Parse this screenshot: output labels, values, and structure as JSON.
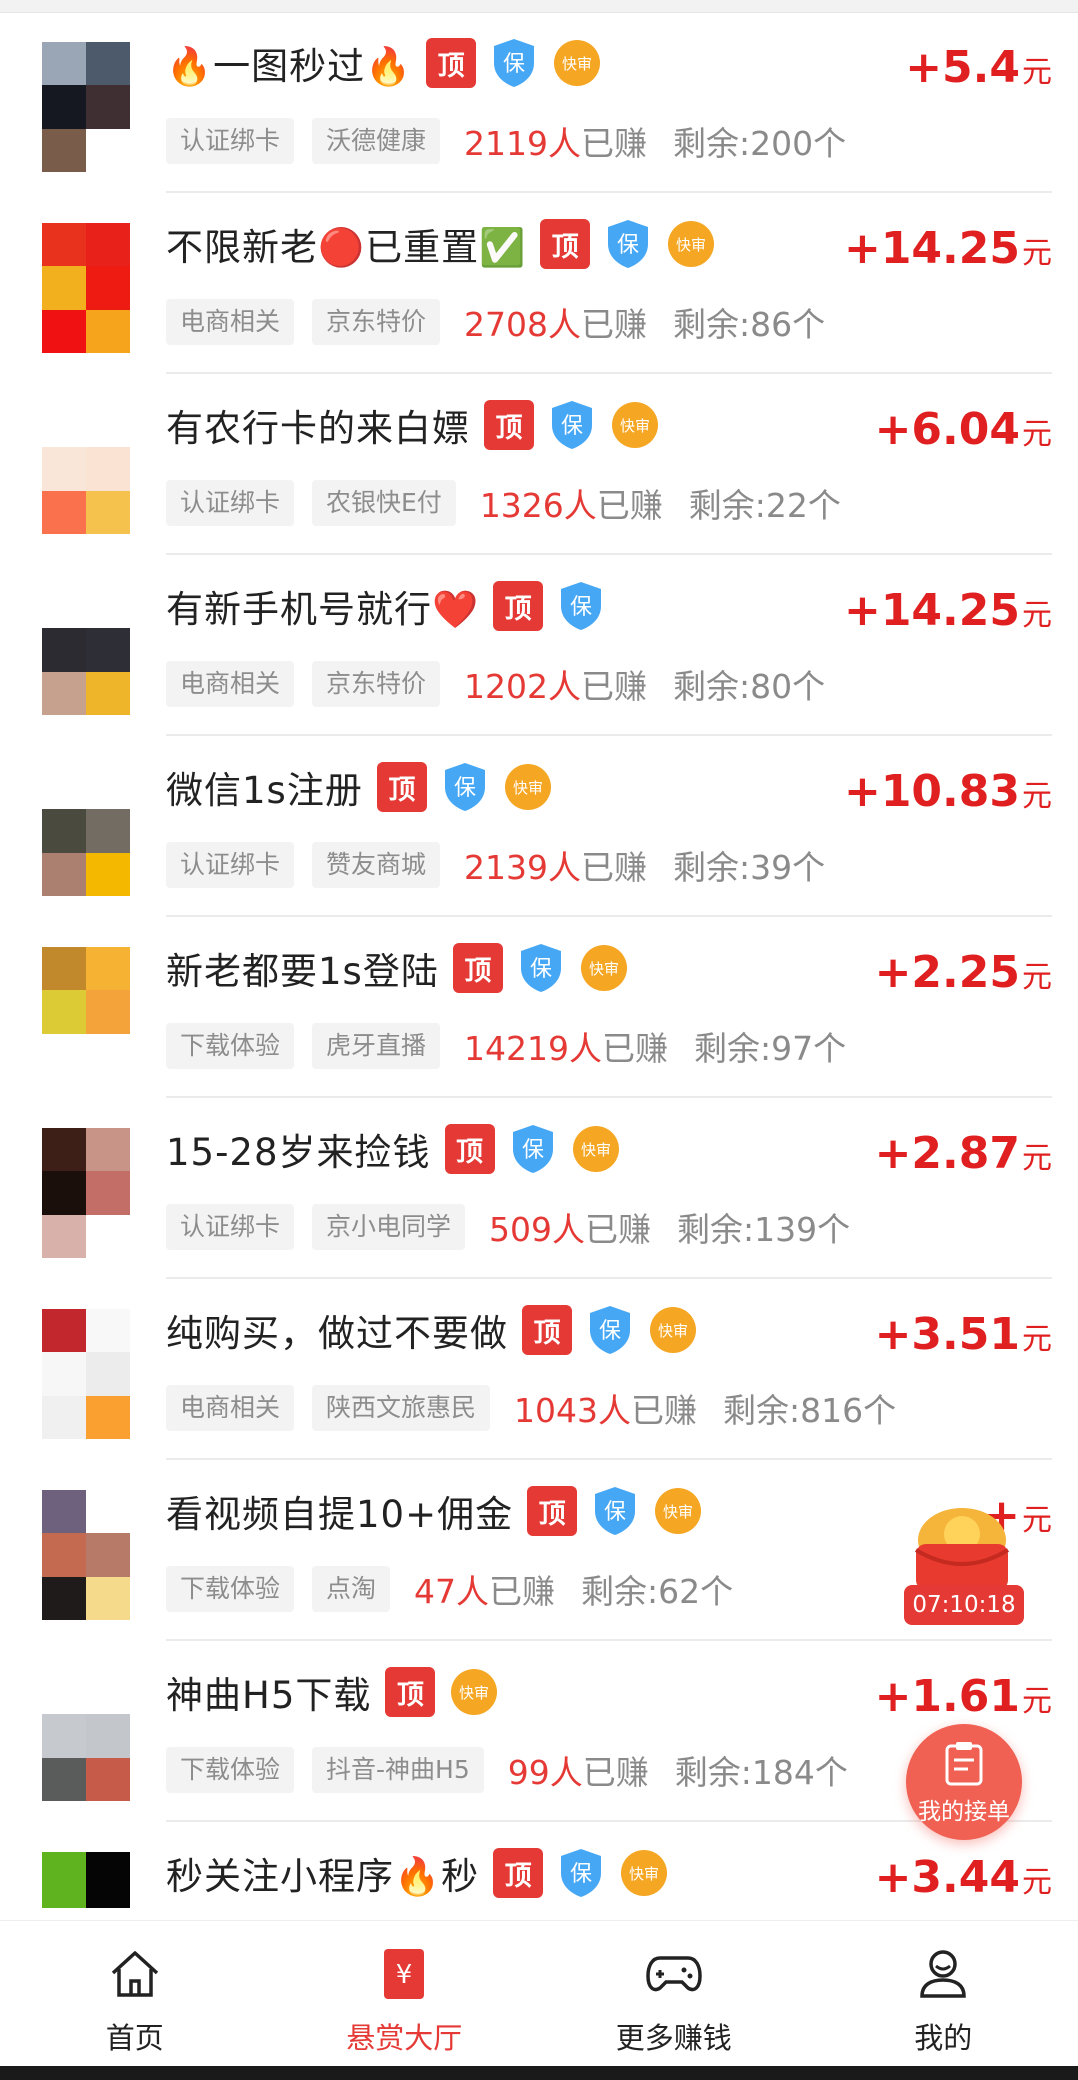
{
  "tasks": [
    {
      "title": "🔥一图秒过🔥",
      "badges": [
        "顶",
        "保",
        "快审"
      ],
      "tags": [
        "认证绑卡",
        "沃德健康"
      ],
      "earned_num": "2119人",
      "earned_suffix": "已赚",
      "remain": "剩余:200个",
      "price": "+5.4",
      "unit": "元"
    },
    {
      "title": "不限新老🔴已重置✅",
      "badges": [
        "顶",
        "保",
        "快审"
      ],
      "tags": [
        "电商相关",
        "京东特价"
      ],
      "earned_num": "2708人",
      "earned_suffix": "已赚",
      "remain": "剩余:86个",
      "price": "+14.25",
      "unit": "元"
    },
    {
      "title": "有农行卡的来白嫖",
      "badges": [
        "顶",
        "保",
        "快审"
      ],
      "tags": [
        "认证绑卡",
        "农银快E付"
      ],
      "earned_num": "1326人",
      "earned_suffix": "已赚",
      "remain": "剩余:22个",
      "price": "+6.04",
      "unit": "元"
    },
    {
      "title": "有新手机号就行❤️",
      "badges": [
        "顶",
        "保"
      ],
      "tags": [
        "电商相关",
        "京东特价"
      ],
      "earned_num": "1202人",
      "earned_suffix": "已赚",
      "remain": "剩余:80个",
      "price": "+14.25",
      "unit": "元"
    },
    {
      "title": "微信1s注册",
      "badges": [
        "顶",
        "保",
        "快审"
      ],
      "tags": [
        "认证绑卡",
        "赞友商城"
      ],
      "earned_num": "2139人",
      "earned_suffix": "已赚",
      "remain": "剩余:39个",
      "price": "+10.83",
      "unit": "元"
    },
    {
      "title": "新老都要1s登陆",
      "badges": [
        "顶",
        "保",
        "快审"
      ],
      "tags": [
        "下载体验",
        "虎牙直播"
      ],
      "earned_num": "14219人",
      "earned_suffix": "已赚",
      "remain": "剩余:97个",
      "price": "+2.25",
      "unit": "元"
    },
    {
      "title": "15-28岁来捡钱",
      "badges": [
        "顶",
        "保",
        "快审"
      ],
      "tags": [
        "认证绑卡",
        "京小电同学"
      ],
      "earned_num": "509人",
      "earned_suffix": "已赚",
      "remain": "剩余:139个",
      "price": "+2.87",
      "unit": "元"
    },
    {
      "title": "纯购买，做过不要做",
      "badges": [
        "顶",
        "保",
        "快审"
      ],
      "tags": [
        "电商相关",
        "陕西文旅惠民"
      ],
      "earned_num": "1043人",
      "earned_suffix": "已赚",
      "remain": "剩余:816个",
      "price": "+3.51",
      "unit": "元"
    },
    {
      "title": "看视频自提10+佣金",
      "badges": [
        "顶",
        "保",
        "快审"
      ],
      "tags": [
        "下载体验",
        "点淘"
      ],
      "earned_num": "47人",
      "earned_suffix": "已赚",
      "remain": "剩余:62个",
      "price": "+",
      "unit": "元"
    },
    {
      "title": "神曲H5下载",
      "badges": [
        "顶",
        "快审"
      ],
      "tags": [
        "下载体验",
        "抖音-神曲H5"
      ],
      "earned_num": "99人",
      "earned_suffix": "已赚",
      "remain": "剩余:184个",
      "price": "+1.61",
      "unit": "元"
    },
    {
      "title": "秒关注小程序🔥秒",
      "badges": [
        "顶",
        "保",
        "快审"
      ],
      "tags": [],
      "earned_num": "",
      "earned_suffix": "",
      "remain": "",
      "price": "+3.44",
      "unit": "元"
    }
  ],
  "float_redpacket": {
    "timer": "07:10:18"
  },
  "my_orders": {
    "label": "我的接单"
  },
  "tabbar": [
    {
      "label": "首页",
      "icon": "home-icon"
    },
    {
      "label": "悬赏大厅",
      "icon": "yuan-icon",
      "active": true
    },
    {
      "label": "更多赚钱",
      "icon": "gamepad-icon"
    },
    {
      "label": "我的",
      "icon": "user-icon"
    }
  ],
  "colors": {
    "accent": "#e53935",
    "price": "#e02020",
    "shield": "#46a7f5",
    "fast": "#f5a623"
  }
}
